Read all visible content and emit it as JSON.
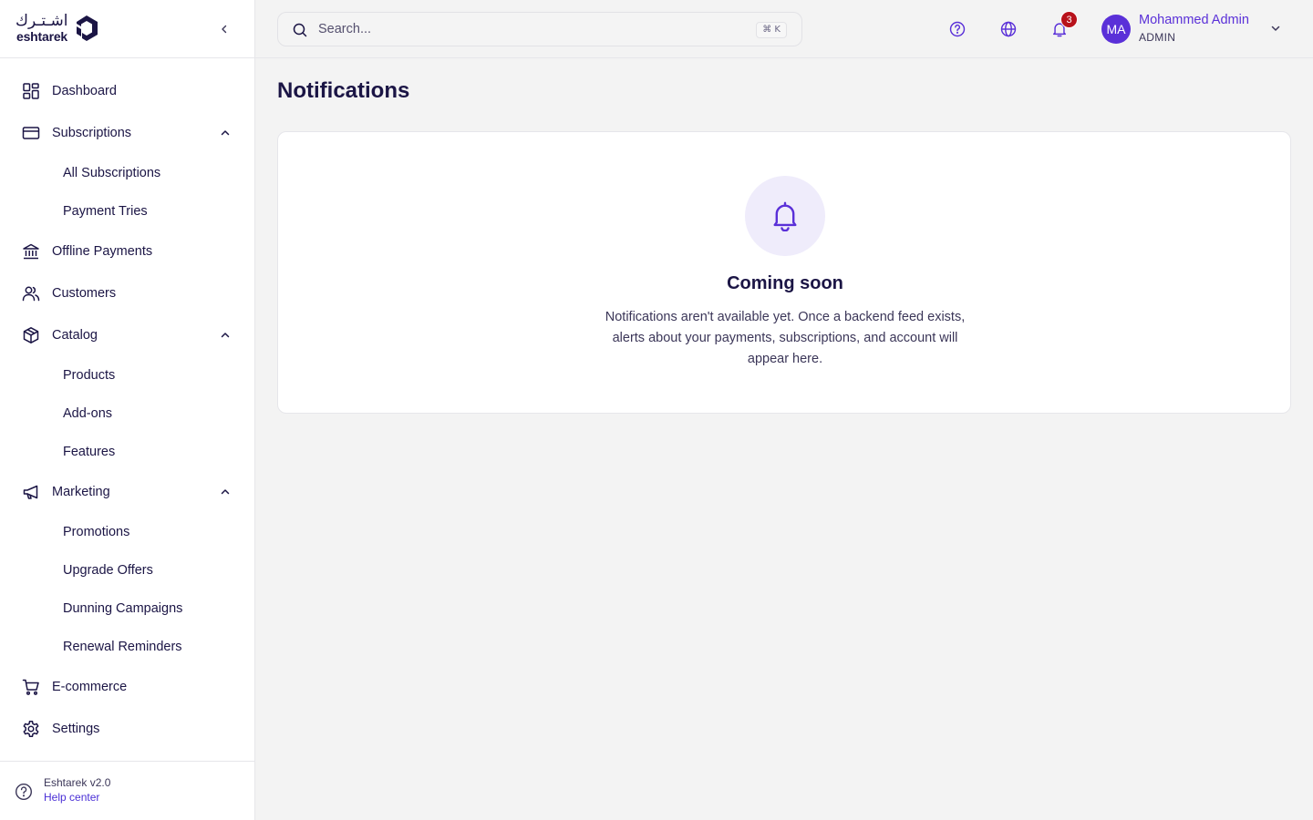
{
  "brand": {
    "name_ar": "اشـتـرك",
    "name_en": "eshtarek",
    "color": "#1b1545"
  },
  "sidebar": {
    "items": [
      {
        "label": "Dashboard",
        "icon": "dashboard-grid-icon"
      },
      {
        "label": "Subscriptions",
        "icon": "credit-card-icon",
        "expanded": true,
        "children": [
          {
            "label": "All Subscriptions"
          },
          {
            "label": "Payment Tries"
          }
        ]
      },
      {
        "label": "Offline Payments",
        "icon": "bank-icon"
      },
      {
        "label": "Customers",
        "icon": "users-icon"
      },
      {
        "label": "Catalog",
        "icon": "package-icon",
        "expanded": true,
        "children": [
          {
            "label": "Products"
          },
          {
            "label": "Add-ons"
          },
          {
            "label": "Features"
          }
        ]
      },
      {
        "label": "Marketing",
        "icon": "megaphone-icon",
        "expanded": true,
        "children": [
          {
            "label": "Promotions"
          },
          {
            "label": "Upgrade Offers"
          },
          {
            "label": "Dunning Campaigns"
          },
          {
            "label": "Renewal Reminders"
          }
        ]
      },
      {
        "label": "E-commerce",
        "icon": "cart-icon"
      },
      {
        "label": "Settings",
        "icon": "gear-icon"
      }
    ],
    "footer": {
      "version": "Eshtarek v2.0",
      "help": "Help center"
    }
  },
  "topbar": {
    "search_placeholder": "Search...",
    "shortcut": "⌘ K",
    "notification_count": "3",
    "user": {
      "initials": "MA",
      "name": "Mohammed Admin",
      "role": "ADMIN"
    }
  },
  "main": {
    "title": "Notifications",
    "empty_state": {
      "title": "Coming soon",
      "text": "Notifications aren't available yet. Once a backend feed exists, alerts about your payments, subscriptions, and account will appear here."
    }
  },
  "colors": {
    "accent": "#5a30d8",
    "badge": "#b8121b",
    "link": "#4a2fd6",
    "empty_icon_bg": "#efecfb"
  }
}
